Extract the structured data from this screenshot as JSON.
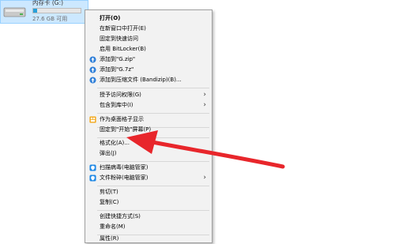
{
  "drive": {
    "name": "内存卡 (G:)",
    "free_text": "27.6 GB 可用",
    "usage_fraction": 0.08,
    "icon": "usb-drive-icon"
  },
  "menu": {
    "items": [
      {
        "label": "打开(O)",
        "bold": true
      },
      {
        "label": "在新窗口中打开(E)"
      },
      {
        "label": "固定到快速访问"
      },
      {
        "label": "启用 BitLocker(B)"
      },
      {
        "label": "添加到\"G.zip\"",
        "icon": "bandizip-icon"
      },
      {
        "label": "添加到\"G.7z\"",
        "icon": "bandizip-icon"
      },
      {
        "label": "添加到压缩文件 (Bandizip)(B)...",
        "icon": "bandizip-icon"
      },
      {
        "label": "授予访问权限(G)",
        "submenu": true
      },
      {
        "label": "包含到库中(I)",
        "submenu": true
      },
      {
        "label": "作为桌面格子显示",
        "icon": "fences-icon"
      },
      {
        "label": "固定到\"开始\"屏幕(P)"
      },
      {
        "label": "格式化(A)..."
      },
      {
        "label": "弹出(J)"
      },
      {
        "label": "扫描病毒(电脑管家)",
        "icon": "shield-icon"
      },
      {
        "label": "文件粉碎(电脑管家)",
        "icon": "shield-icon",
        "submenu": true
      },
      {
        "label": "剪切(T)"
      },
      {
        "label": "复制(C)"
      },
      {
        "label": "创建快捷方式(S)"
      },
      {
        "label": "重命名(M)"
      },
      {
        "label": "属性(R)"
      }
    ]
  },
  "colors": {
    "annotation_arrow": "#e8262b",
    "drive_selection": "#cce8ff",
    "usage_bar": "#26a0da",
    "bandizip_icon": "#2f7fd8",
    "fences_icon": "#f2a20b",
    "shield_icon": "#1e88e5"
  }
}
